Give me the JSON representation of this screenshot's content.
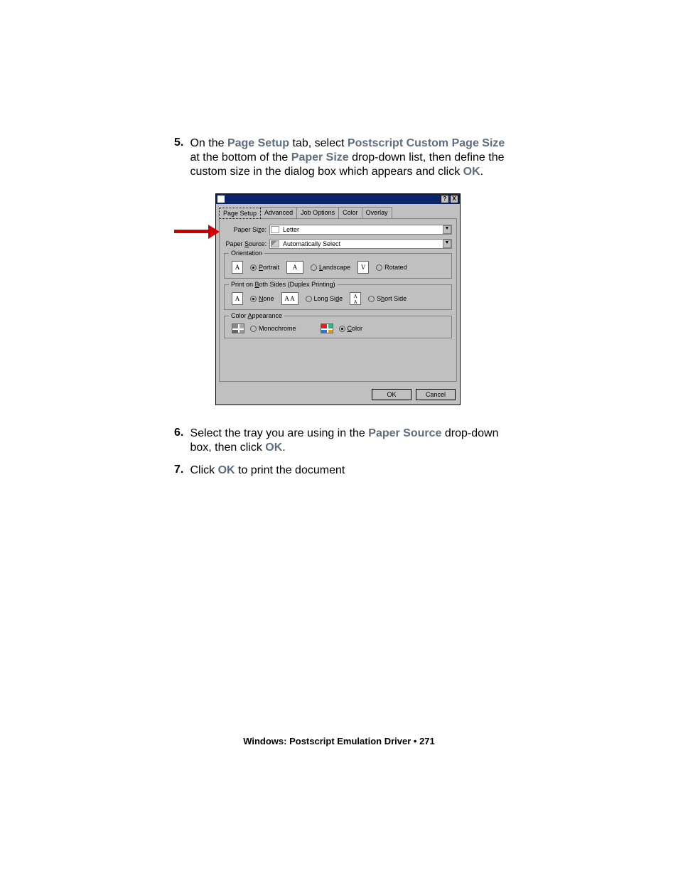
{
  "steps": {
    "s5": {
      "num": "5.",
      "p1a": "On the ",
      "p1b": "Page Setup",
      "p1c": " tab, select ",
      "p1d": "Postscript Custom Page Size",
      "p1e": " at the bottom of the ",
      "p1f": "Paper Size",
      "p1g": " drop-down list, then define the custom size in the dialog box which appears and click ",
      "p1h": "OK",
      "p1i": "."
    },
    "s6": {
      "num": "6.",
      "a": "Select the tray you are using in the ",
      "b": "Paper Source",
      "c": " drop-down box, then click ",
      "d": "OK",
      "e": "."
    },
    "s7": {
      "num": "7.",
      "a": "Click ",
      "b": "OK",
      "c": " to print the document"
    }
  },
  "dialog": {
    "help": "?",
    "close": "X",
    "tabs": {
      "page_setup": "Page Setup",
      "advanced": "Advanced",
      "job_options": "Job Options",
      "color": "Color",
      "overlay": "Overlay"
    },
    "paper_size_label": "Paper Si",
    "paper_size_label_u": "z",
    "paper_size_label_end": "e:",
    "paper_size_value": "Letter",
    "paper_source_label_a": "Paper ",
    "paper_source_label_u": "S",
    "paper_source_label_b": "ource:",
    "paper_source_value": "Automatically Select",
    "orientation": {
      "legend": "Orientation",
      "portrait_u": "P",
      "portrait": "ortrait",
      "landscape_u": "L",
      "landscape": "andscape",
      "rotated": "Rotated",
      "iconA": "A",
      "iconV": "V"
    },
    "duplex": {
      "legend_a": "Print on ",
      "legend_u": "B",
      "legend_b": "oth Sides (Duplex Printing)",
      "none_u": "N",
      "none": "one",
      "long_a": "Long Si",
      "long_u": "d",
      "long_b": "e",
      "short_a": "S",
      "short_u": "h",
      "short_b": "ort Side",
      "iconA": "A",
      "iconAA": "A A",
      "iconStack": "A\nA"
    },
    "color": {
      "legend_a": "Color ",
      "legend_u": "A",
      "legend_b": "ppearance",
      "mono": "Monochrome",
      "color_u": "C",
      "color": "olor"
    },
    "buttons": {
      "ok": "OK",
      "cancel": "Cancel"
    }
  },
  "footer": {
    "a": "Windows: Postscript Emulation Driver",
    "sep": "   •   ",
    "page": "271"
  }
}
